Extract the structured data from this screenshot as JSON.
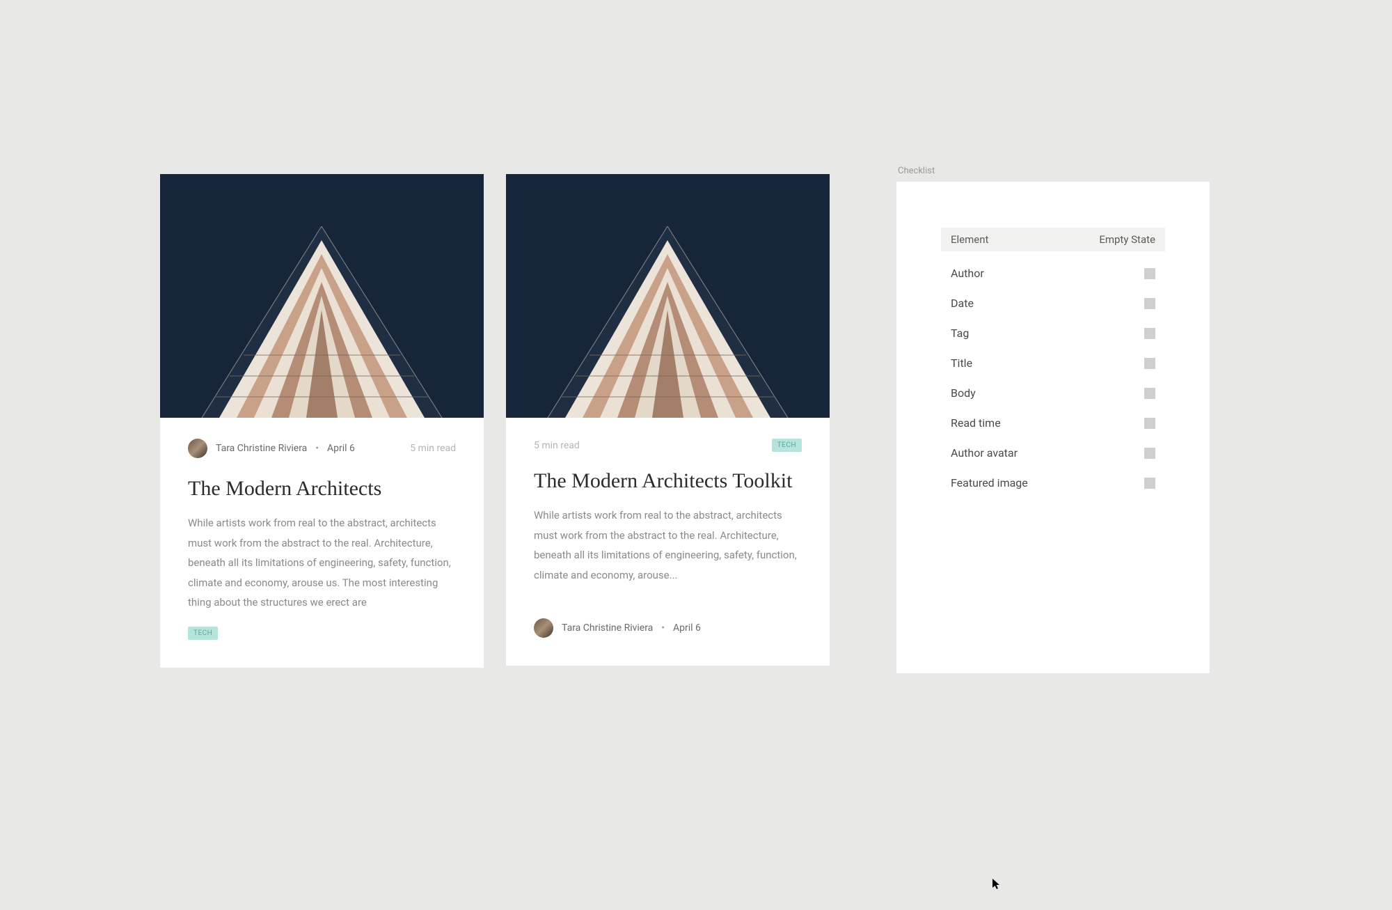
{
  "cards": [
    {
      "author": "Tara Christine Riviera",
      "date": "April 6",
      "readtime": "5 min read",
      "title": "The Modern Architects",
      "body": "While artists work from real to the abstract, architects must work from the abstract to the real. Architecture, beneath all its limitations of engineering, safety, function, climate and economy, arouse us. The most interesting thing about the structures we erect are",
      "tag": "TECH"
    },
    {
      "author": "Tara Christine Riviera",
      "date": "April 6",
      "readtime": "5 min read",
      "title": "The Modern Architects Toolkit",
      "body": "While artists work from real to the abstract, architects must work from the abstract to the real. Architecture, beneath all its limitations of engineering, safety, function, climate and economy, arouse...",
      "tag": "TECH"
    }
  ],
  "checklist": {
    "label": "Checklist",
    "header": {
      "col1": "Element",
      "col2": "Empty State"
    },
    "rows": [
      "Author",
      "Date",
      "Tag",
      "Title",
      "Body",
      "Read time",
      "Author avatar",
      "Featured image"
    ]
  }
}
